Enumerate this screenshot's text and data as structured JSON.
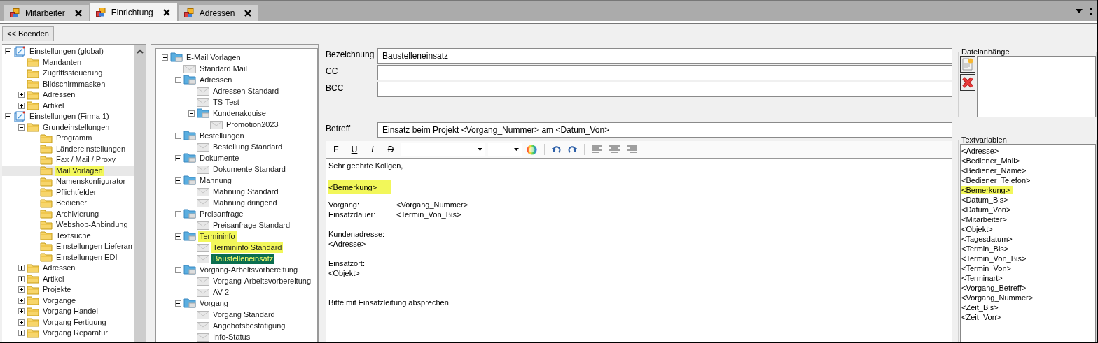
{
  "tabs": [
    {
      "label": "Mitarbeiter",
      "selected": false
    },
    {
      "label": "Einrichtung",
      "selected": true
    },
    {
      "label": "Adressen",
      "selected": false
    }
  ],
  "back_button": "<< Beenden",
  "settings_tree": [
    {
      "label": "Einstellungen (global)",
      "kind": "settings",
      "expanded": true,
      "selected": false,
      "highlighted": false,
      "children": [
        {
          "label": "Mandanten",
          "kind": "folder",
          "selected": false,
          "highlighted": false
        },
        {
          "label": "Zugriffssteuerung",
          "kind": "folder",
          "selected": false,
          "highlighted": false
        },
        {
          "label": "Bildschirmmasken",
          "kind": "folder",
          "selected": false,
          "highlighted": false
        },
        {
          "label": "Adressen",
          "kind": "folder",
          "expanded": false,
          "selected": false,
          "highlighted": false
        },
        {
          "label": "Artikel",
          "kind": "folder",
          "expanded": false,
          "selected": false,
          "highlighted": false
        }
      ]
    },
    {
      "label": "Einstellungen (Firma 1)",
      "kind": "settings",
      "expanded": true,
      "selected": false,
      "highlighted": false,
      "children": [
        {
          "label": "Grundeinstellungen",
          "kind": "folder",
          "expanded": true,
          "selected": false,
          "highlighted": false,
          "children": [
            {
              "label": "Programm",
              "kind": "folder",
              "selected": false,
              "highlighted": false
            },
            {
              "label": "Ländereinstellungen",
              "kind": "folder",
              "selected": false,
              "highlighted": false
            },
            {
              "label": "Fax / Mail / Proxy",
              "kind": "folder",
              "selected": false,
              "highlighted": false
            },
            {
              "label": "Mail Vorlagen",
              "kind": "folder",
              "selected": true,
              "highlighted": true
            },
            {
              "label": "Namenskonfigurator",
              "kind": "folder",
              "selected": false,
              "highlighted": false
            },
            {
              "label": "Pflichtfelder",
              "kind": "folder",
              "selected": false,
              "highlighted": false
            },
            {
              "label": "Bediener",
              "kind": "folder",
              "selected": false,
              "highlighted": false
            },
            {
              "label": "Archivierung",
              "kind": "folder",
              "selected": false,
              "highlighted": false
            },
            {
              "label": "Webshop-Anbindung",
              "kind": "folder",
              "selected": false,
              "highlighted": false
            },
            {
              "label": "Textsuche",
              "kind": "folder",
              "selected": false,
              "highlighted": false
            },
            {
              "label": "Einstellungen Lieferan",
              "kind": "folder",
              "selected": false,
              "highlighted": false
            },
            {
              "label": "Einstellungen EDI",
              "kind": "folder",
              "selected": false,
              "highlighted": false
            }
          ]
        },
        {
          "label": "Adressen",
          "kind": "folder",
          "expanded": false,
          "selected": false,
          "highlighted": false
        },
        {
          "label": "Artikel",
          "kind": "folder",
          "expanded": false,
          "selected": false,
          "highlighted": false
        },
        {
          "label": "Projekte",
          "kind": "folder",
          "expanded": false,
          "selected": false,
          "highlighted": false
        },
        {
          "label": "Vorgänge",
          "kind": "folder",
          "expanded": false,
          "selected": false,
          "highlighted": false
        },
        {
          "label": "Vorgang Handel",
          "kind": "folder",
          "expanded": false,
          "selected": false,
          "highlighted": false
        },
        {
          "label": "Vorgang Fertigung",
          "kind": "folder",
          "expanded": false,
          "selected": false,
          "highlighted": false
        },
        {
          "label": "Vorgang Reparatur",
          "kind": "folder",
          "expanded": false,
          "selected": false,
          "highlighted": false
        }
      ]
    }
  ],
  "template_tree": [
    {
      "label": "E-Mail Vorlagen",
      "kind": "group",
      "expanded": true,
      "selected": false,
      "highlighted": false,
      "children": [
        {
          "label": "Standard Mail",
          "kind": "mail",
          "selected": false,
          "highlighted": false
        },
        {
          "label": "Adressen",
          "kind": "group",
          "expanded": true,
          "selected": false,
          "highlighted": false,
          "children": [
            {
              "label": "Adressen Standard",
              "kind": "mail",
              "selected": false,
              "highlighted": false
            },
            {
              "label": "TS-Test",
              "kind": "mail",
              "selected": false,
              "highlighted": false
            },
            {
              "label": "Kundenakquise",
              "kind": "group",
              "expanded": true,
              "selected": false,
              "highlighted": false,
              "children": [
                {
                  "label": "Promotion2023",
                  "kind": "mail",
                  "selected": false,
                  "highlighted": false
                }
              ]
            }
          ]
        },
        {
          "label": "Bestellungen",
          "kind": "group",
          "expanded": true,
          "selected": false,
          "highlighted": false,
          "children": [
            {
              "label": "Bestellung Standard",
              "kind": "mail",
              "selected": false,
              "highlighted": false
            }
          ]
        },
        {
          "label": "Dokumente",
          "kind": "group",
          "expanded": true,
          "selected": false,
          "highlighted": false,
          "children": [
            {
              "label": "Dokumente Standard",
              "kind": "mail",
              "selected": false,
              "highlighted": false
            }
          ]
        },
        {
          "label": "Mahnung",
          "kind": "group",
          "expanded": true,
          "selected": false,
          "highlighted": false,
          "children": [
            {
              "label": "Mahnung Standard",
              "kind": "mail",
              "selected": false,
              "highlighted": false
            },
            {
              "label": "Mahnung dringend",
              "kind": "mail",
              "selected": false,
              "highlighted": false
            }
          ]
        },
        {
          "label": "Preisanfrage",
          "kind": "group",
          "expanded": true,
          "selected": false,
          "highlighted": false,
          "children": [
            {
              "label": "Preisanfrage Standard",
              "kind": "mail",
              "selected": false,
              "highlighted": false
            }
          ]
        },
        {
          "label": "Termininfo",
          "kind": "group",
          "expanded": true,
          "selected": false,
          "highlighted": true,
          "children": [
            {
              "label": "Termininfo Standard",
              "kind": "mail",
              "selected": false,
              "highlighted": true
            },
            {
              "label": "Baustelleneinsatz",
              "kind": "mail",
              "selected": true,
              "highlighted": true
            }
          ]
        },
        {
          "label": "Vorgang-Arbeitsvorbereitung",
          "kind": "group",
          "expanded": true,
          "selected": false,
          "highlighted": false,
          "children": [
            {
              "label": "Vorgang-Arbeitsvorbereitung",
              "kind": "mail",
              "selected": false,
              "highlighted": false
            },
            {
              "label": "AV 2",
              "kind": "mail",
              "selected": false,
              "highlighted": false
            }
          ]
        },
        {
          "label": "Vorgang",
          "kind": "group",
          "expanded": true,
          "selected": false,
          "highlighted": false,
          "children": [
            {
              "label": "Vorgang Standard",
              "kind": "mail",
              "selected": false,
              "highlighted": false
            },
            {
              "label": "Angebotsbestätigung",
              "kind": "mail",
              "selected": false,
              "highlighted": false
            },
            {
              "label": "Info-Status",
              "kind": "mail",
              "selected": false,
              "highlighted": false
            }
          ]
        }
      ]
    }
  ],
  "form": {
    "fields": [
      {
        "label": "Bezeichnung",
        "value": "Baustelleneinsatz"
      },
      {
        "label": "CC"
      },
      {
        "label": "BCC"
      }
    ],
    "subject": {
      "label": "Betreff",
      "value": "Einsatz beim Projekt <Vorgang_Nummer> am <Datum_Von>"
    }
  },
  "editor": {
    "toolbar": {
      "bold": "F",
      "underline": "U",
      "italic": "I",
      "strike": "D"
    },
    "lines": [
      {
        "kind": "text",
        "text": "Sehr geehrte Kollgen,",
        "highlighted": false
      },
      {
        "kind": "blank"
      },
      {
        "kind": "text",
        "text": "<Bemerkung>",
        "highlighted": true
      },
      {
        "kind": "blank"
      },
      {
        "kind": "pair",
        "text": "Vorgang:",
        "value": "<Vorgang_Nummer>"
      },
      {
        "kind": "pair",
        "text": "Einsatzdauer:",
        "value": "<Termin_Von_Bis>"
      },
      {
        "kind": "blank"
      },
      {
        "kind": "text",
        "text": "Kundenadresse:",
        "highlighted": false
      },
      {
        "kind": "text",
        "text": "<Adresse>",
        "highlighted": false
      },
      {
        "kind": "blank"
      },
      {
        "kind": "text",
        "text": "Einsatzort:",
        "highlighted": false
      },
      {
        "kind": "text",
        "text": "<Objekt>",
        "highlighted": false
      },
      {
        "kind": "blank"
      },
      {
        "kind": "blank"
      },
      {
        "kind": "text",
        "text": "Bitte mit Einsatzleitung absprechen",
        "highlighted": false
      }
    ]
  },
  "attachments": {
    "title": "Dateianhänge"
  },
  "text_variables": {
    "title": "Textvariablen",
    "items": [
      {
        "label": "<Adresse>",
        "highlighted": false
      },
      {
        "label": "<Bediener_Mail>",
        "highlighted": false
      },
      {
        "label": "<Bediener_Name>",
        "highlighted": false
      },
      {
        "label": "<Bediener_Telefon>",
        "highlighted": false
      },
      {
        "label": "<Bemerkung>",
        "highlighted": true
      },
      {
        "label": "<Datum_Bis>",
        "highlighted": false
      },
      {
        "label": "<Datum_Von>",
        "highlighted": false
      },
      {
        "label": "<Mitarbeiter>",
        "highlighted": false
      },
      {
        "label": "<Objekt>",
        "highlighted": false
      },
      {
        "label": "<Tagesdatum>",
        "highlighted": false
      },
      {
        "label": "<Termin_Bis>",
        "highlighted": false
      },
      {
        "label": "<Termin_Von_Bis>",
        "highlighted": false
      },
      {
        "label": "<Termin_Von>",
        "highlighted": false
      },
      {
        "label": "<Terminart>",
        "highlighted": false
      },
      {
        "label": "<Vorgang_Betreff>",
        "highlighted": false
      },
      {
        "label": "<Vorgang_Nummer>",
        "highlighted": false
      },
      {
        "label": "<Zeit_Bis>",
        "highlighted": false
      },
      {
        "label": "<Zeit_Von>",
        "highlighted": false
      }
    ]
  }
}
